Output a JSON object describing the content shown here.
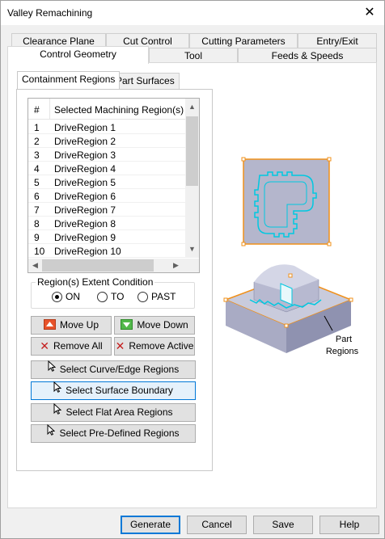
{
  "window": {
    "title": "Valley Remachining",
    "close_glyph": "✕"
  },
  "tabs_row1": [
    "Clearance Plane",
    "Cut Control",
    "Cutting Parameters",
    "Entry/Exit"
  ],
  "tabs_row2": [
    "Control Geometry",
    "Tool",
    "Feeds & Speeds"
  ],
  "active_tab": "Control Geometry",
  "subtabs": [
    "Containment Regions",
    "Part Surfaces"
  ],
  "active_subtab": "Containment Regions",
  "regions_list": {
    "header_num": "#",
    "header_name": "Selected Machining Region(s)",
    "rows": [
      {
        "num": "1",
        "name": "DriveRegion 1"
      },
      {
        "num": "2",
        "name": "DriveRegion 2"
      },
      {
        "num": "3",
        "name": "DriveRegion 3"
      },
      {
        "num": "4",
        "name": "DriveRegion 4"
      },
      {
        "num": "5",
        "name": "DriveRegion 5"
      },
      {
        "num": "6",
        "name": "DriveRegion 6"
      },
      {
        "num": "7",
        "name": "DriveRegion 7"
      },
      {
        "num": "8",
        "name": "DriveRegion 8"
      },
      {
        "num": "9",
        "name": "DriveRegion 9"
      },
      {
        "num": "10",
        "name": "DriveRegion 10"
      }
    ]
  },
  "extent_condition": {
    "label": "Region(s) Extent Condition",
    "options": [
      "ON",
      "TO",
      "PAST"
    ],
    "selected": "ON"
  },
  "buttons": {
    "move_up": "Move Up",
    "move_down": "Move Down",
    "remove_all": "Remove All",
    "remove_active": "Remove Active",
    "select_curve": "Select Curve/Edge Regions",
    "select_surface": "Select Surface Boundary",
    "select_flat": "Select Flat Area Regions",
    "select_predefined": "Select Pre-Defined Regions"
  },
  "illustration": {
    "label_line1": "Part",
    "label_line2": "Regions"
  },
  "footer": {
    "generate": "Generate",
    "cancel": "Cancel",
    "save": "Save",
    "help": "Help"
  },
  "colors": {
    "region_outline": "#00c8e0",
    "selection_orange": "#f0901a",
    "focus_blue": "#0078d7"
  }
}
